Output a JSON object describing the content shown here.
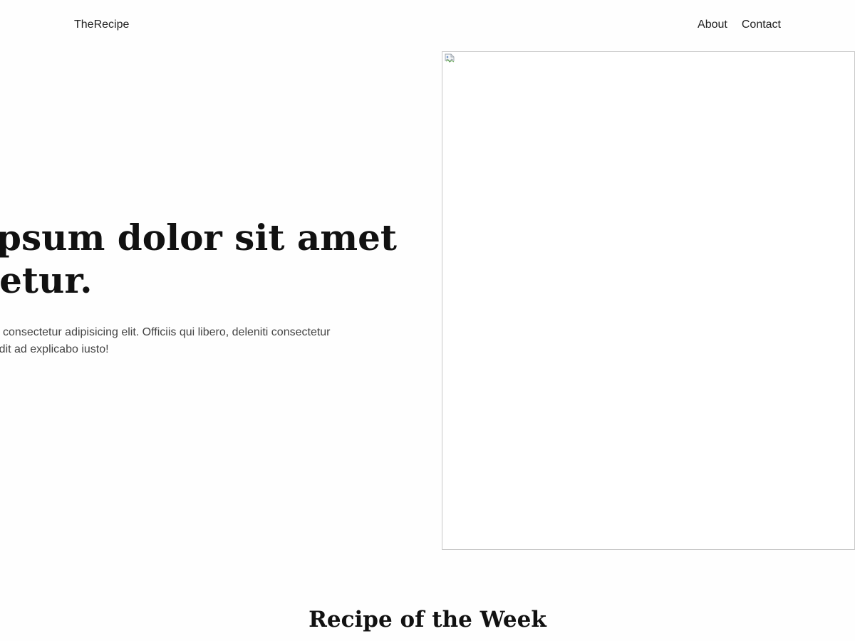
{
  "header": {
    "brand": "TheRecipe",
    "nav": [
      {
        "label": "About"
      },
      {
        "label": "Contact"
      }
    ]
  },
  "hero": {
    "heading_line1": "ipsum dolor sit amet",
    "heading_line2": "tetur.",
    "text_line1": "amet consectetur adipisicing elit. Officiis qui libero, deleniti consectetur",
    "text_line2": "impedit ad explicabo iusto!",
    "image_icon": "broken-image-icon"
  },
  "section": {
    "title": "Recipe of the Week"
  }
}
